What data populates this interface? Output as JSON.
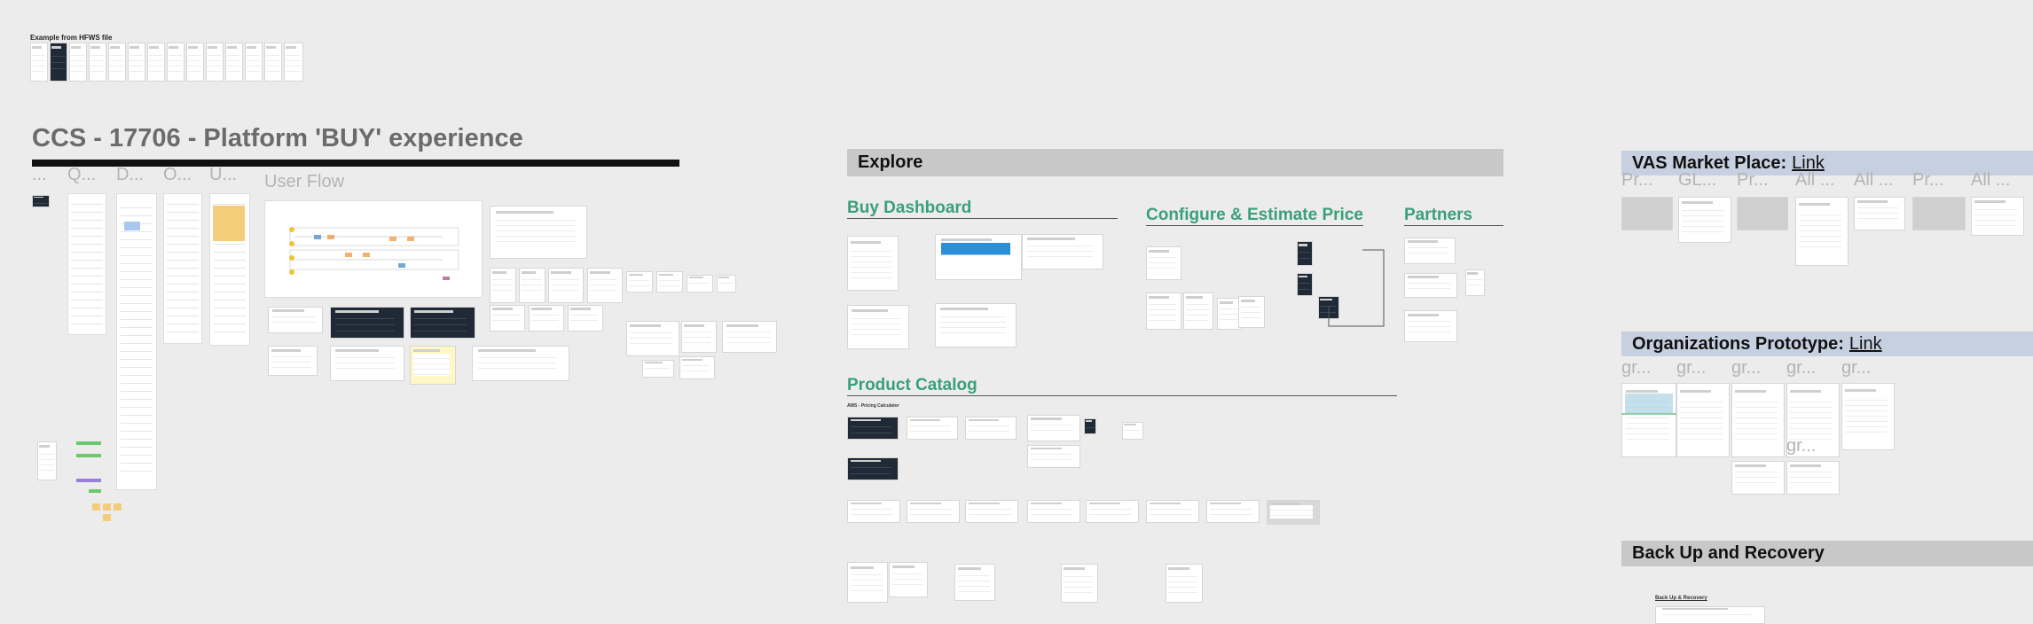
{
  "example": {
    "title": "Example from HFWS file"
  },
  "ccs": {
    "title": "CCS - 17706 - Platform 'BUY' experience",
    "column_labels": [
      "...",
      "Q...",
      "D...",
      "O...",
      "U..."
    ],
    "user_flow_label": "User Flow"
  },
  "explore": {
    "header": "Explore",
    "buy_dashboard": "Buy Dashboard",
    "configure": "Configure & Estimate Price",
    "partners": "Partners",
    "product_catalog": "Product Catalog",
    "aws_pricing": "AWS - Pricing Calculator"
  },
  "vas": {
    "title": "VAS Market Place:",
    "link": "Link",
    "labels": [
      "Pr...",
      "GL...",
      "Pr...",
      "All ...",
      "All ...",
      "Pr...",
      "All ..."
    ]
  },
  "orgs": {
    "title": "Organizations Prototype:",
    "link": "Link",
    "labels": [
      "gr...",
      "gr...",
      "gr...",
      "gr...",
      "gr..."
    ],
    "lower_labels": [
      "gr...",
      "gr..."
    ]
  },
  "backup": {
    "title": "Back Up and Recovery",
    "sub": "Back Up & Recovery"
  },
  "colors": {
    "green": "#3aa07a",
    "bar_blue": "#c7d0e0",
    "bar_gray": "#c8c8c8"
  }
}
